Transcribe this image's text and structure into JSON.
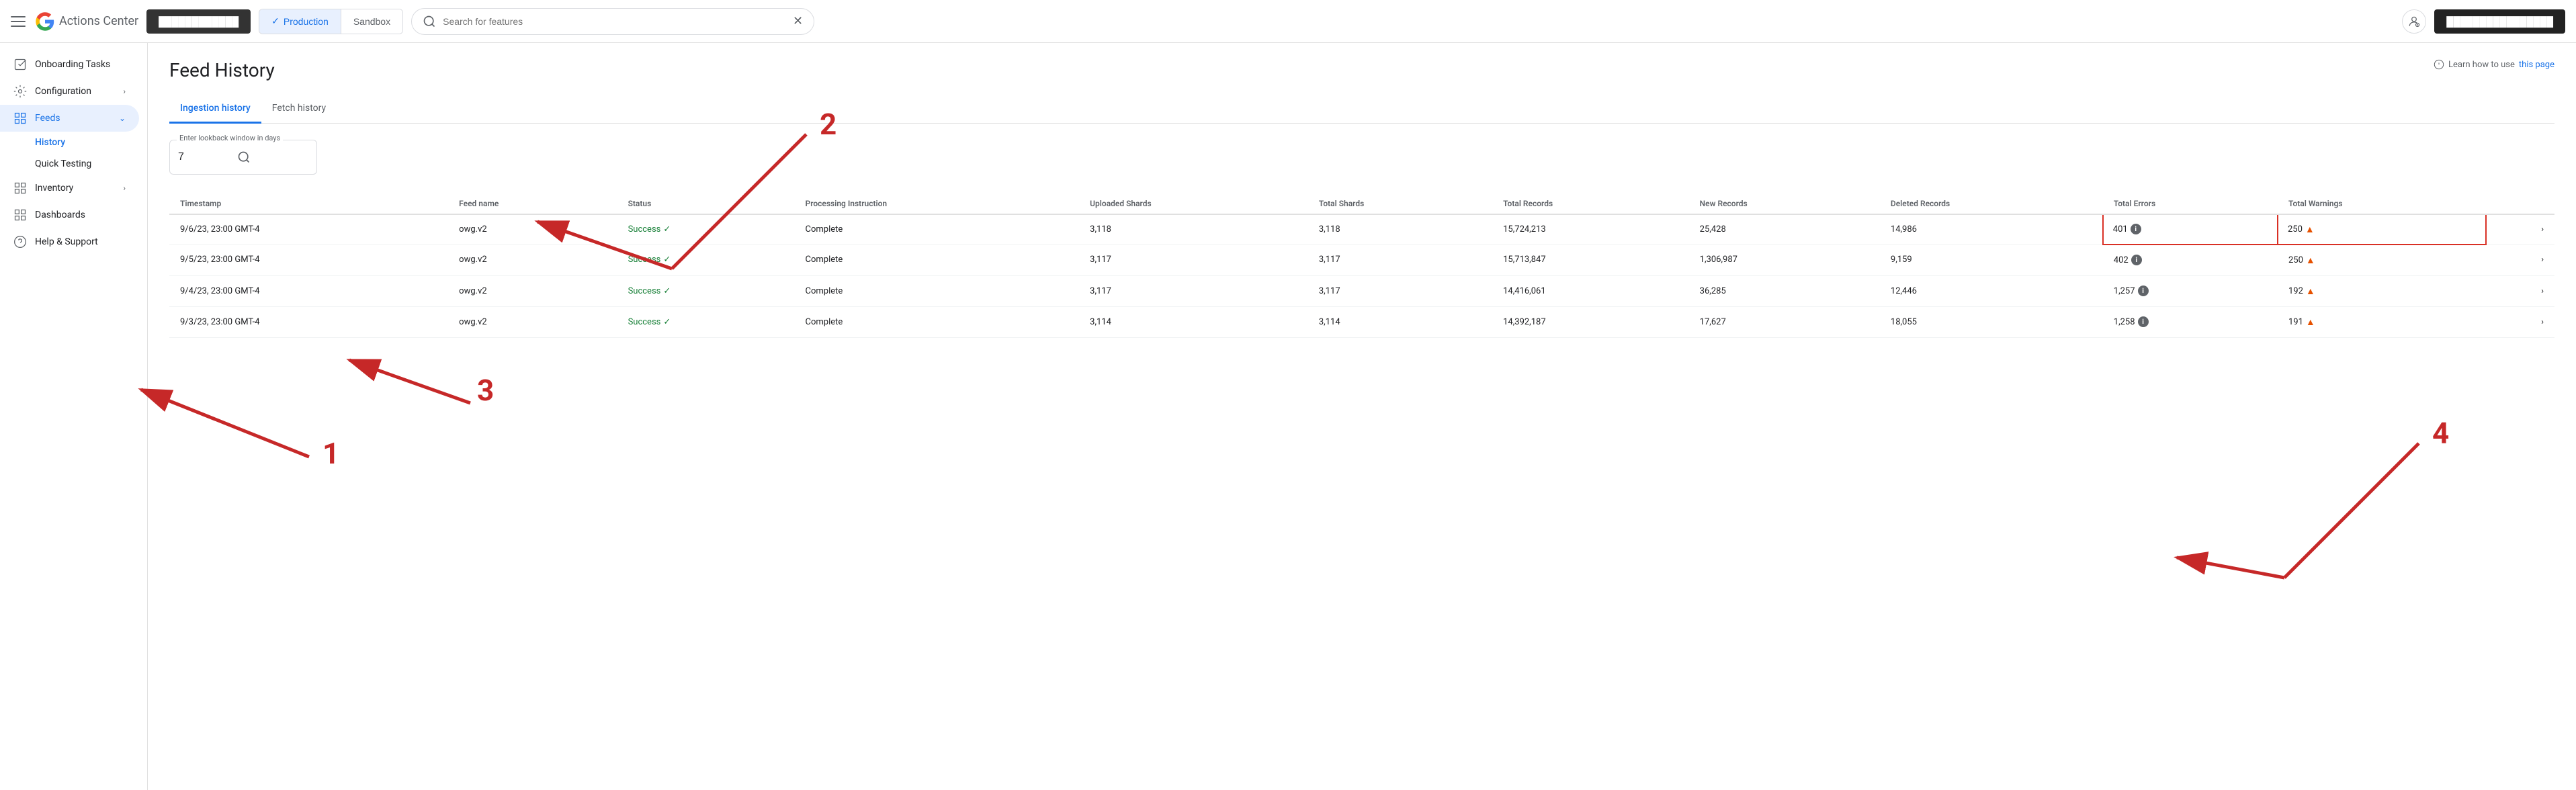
{
  "header": {
    "menu_label": "Main menu",
    "logo_text": "Actions Center",
    "account_btn": "████████████",
    "search_placeholder": "Search for features",
    "env_tabs": [
      {
        "label": "Production",
        "active": true
      },
      {
        "label": "Sandbox",
        "active": false
      }
    ],
    "user_btn": "████████████████"
  },
  "sidebar": {
    "items": [
      {
        "id": "onboarding",
        "label": "Onboarding Tasks",
        "icon": "task-icon"
      },
      {
        "id": "configuration",
        "label": "Configuration",
        "icon": "gear-icon",
        "expandable": true
      },
      {
        "id": "feeds",
        "label": "Feeds",
        "icon": "grid-icon",
        "expandable": true,
        "expanded": true
      },
      {
        "id": "inventory",
        "label": "Inventory",
        "icon": "grid-icon",
        "expandable": true
      },
      {
        "id": "dashboards",
        "label": "Dashboards",
        "icon": "grid-icon"
      },
      {
        "id": "help",
        "label": "Help & Support",
        "icon": "help-icon"
      }
    ],
    "feeds_sub": [
      {
        "id": "history",
        "label": "History",
        "active": true
      },
      {
        "id": "quick-testing",
        "label": "Quick Testing",
        "active": false
      }
    ]
  },
  "main": {
    "page_title": "Feed History",
    "learn_prefix": "Learn how to use",
    "learn_link_text": "this page",
    "tabs": [
      {
        "id": "ingestion",
        "label": "Ingestion history",
        "active": true
      },
      {
        "id": "fetch",
        "label": "Fetch history",
        "active": false
      }
    ],
    "lookback": {
      "label": "Enter lookback window in days",
      "value": "7"
    },
    "table": {
      "columns": [
        "Timestamp",
        "Feed name",
        "Status",
        "Processing Instruction",
        "Uploaded Shards",
        "Total Shards",
        "Total Records",
        "New Records",
        "Deleted Records",
        "Total Errors",
        "Total Warnings",
        ""
      ],
      "rows": [
        {
          "timestamp": "9/6/23, 23:00 GMT-4",
          "feed_name": "owg.v2",
          "status": "Success",
          "processing_instruction": "Complete",
          "uploaded_shards": "3,118",
          "total_shards": "3,118",
          "total_records": "15,724,213",
          "new_records": "25,428",
          "deleted_records": "14,986",
          "total_errors": "401",
          "total_warnings": "250",
          "highlight": true
        },
        {
          "timestamp": "9/5/23, 23:00 GMT-4",
          "feed_name": "owg.v2",
          "status": "Success",
          "processing_instruction": "Complete",
          "uploaded_shards": "3,117",
          "total_shards": "3,117",
          "total_records": "15,713,847",
          "new_records": "1,306,987",
          "deleted_records": "9,159",
          "total_errors": "402",
          "total_warnings": "250",
          "highlight": false
        },
        {
          "timestamp": "9/4/23, 23:00 GMT-4",
          "feed_name": "owg.v2",
          "status": "Success",
          "processing_instruction": "Complete",
          "uploaded_shards": "3,117",
          "total_shards": "3,117",
          "total_records": "14,416,061",
          "new_records": "36,285",
          "deleted_records": "12,446",
          "total_errors": "1,257",
          "total_warnings": "192",
          "highlight": false
        },
        {
          "timestamp": "9/3/23, 23:00 GMT-4",
          "feed_name": "owg.v2",
          "status": "Success",
          "processing_instruction": "Complete",
          "uploaded_shards": "3,114",
          "total_shards": "3,114",
          "total_records": "14,392,187",
          "new_records": "17,627",
          "deleted_records": "18,055",
          "total_errors": "1,258",
          "total_warnings": "191",
          "highlight": false
        }
      ]
    }
  },
  "annotations": {
    "num1": "1",
    "num2": "2",
    "num3": "3",
    "num4": "4"
  }
}
